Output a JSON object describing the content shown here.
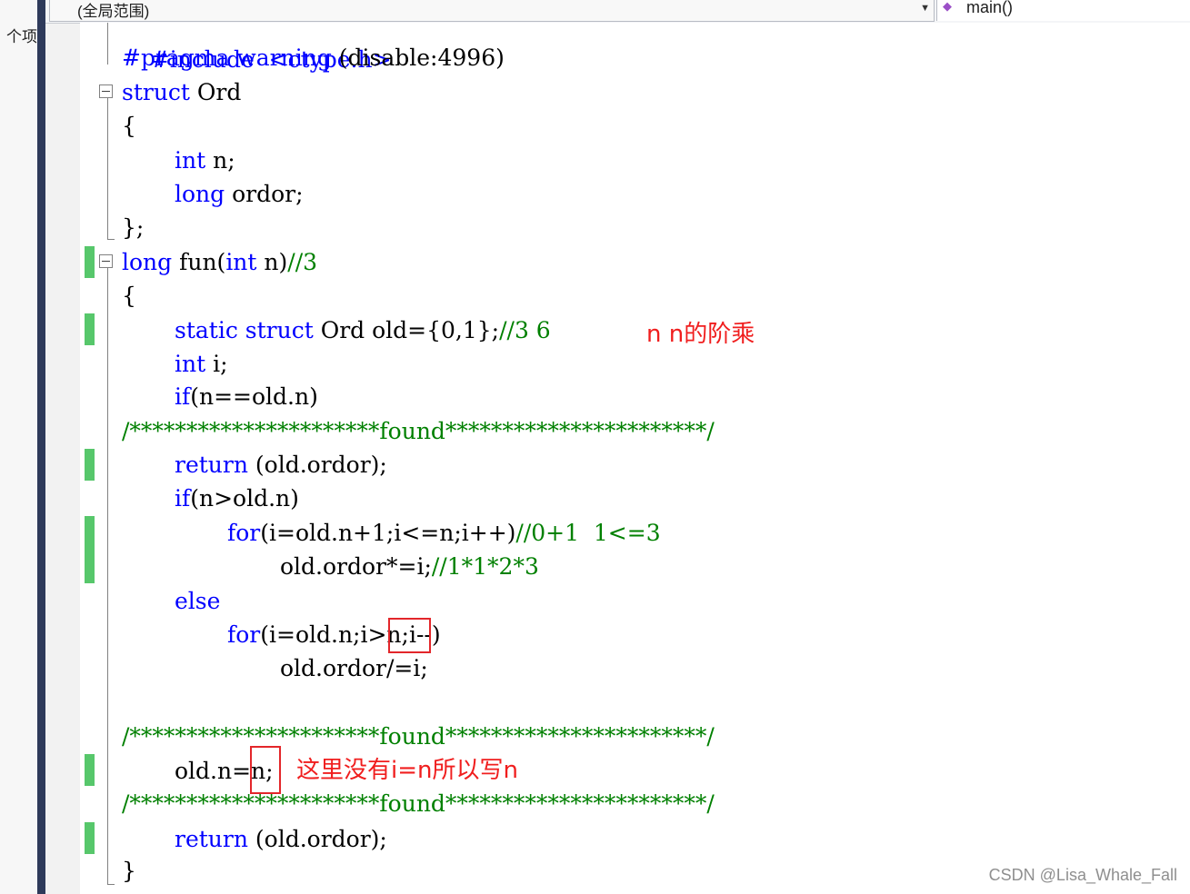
{
  "left_panel": {
    "label": "个项"
  },
  "nav": {
    "scope": "(全局范围)",
    "member": "main()"
  },
  "code": {
    "l0": "#include  <ctype.h>",
    "l1_pp": "#pragma warning",
    "l1_rest": " (disable:4996)",
    "l2_kw": "struct",
    "l2_rest": " Ord",
    "l3": "{",
    "l4_kw": "int",
    "l4_rest": " n;",
    "l5_kw": "long",
    "l5_rest": " ordor;",
    "l6": "};",
    "l7_kw1": "long",
    "l7_mid": " fun(",
    "l7_kw2": "int",
    "l7_rest": " n)",
    "l7_cm": "//3",
    "l8": "{",
    "l9_kw": "static struct",
    "l9_rest": " Ord old={0,1};",
    "l9_cm": "//3 6",
    "l10_kw": "int",
    "l10_rest": " i;",
    "l11_kw": "if",
    "l11_rest": "(n==old.n)",
    "l12_cm": "/**********************found***********************/",
    "l13_kw": "return",
    "l13_rest": " (old.ordor);",
    "l14_kw": "if",
    "l14_rest": "(n>old.n)",
    "l15_kw": "for",
    "l15_rest": "(i=old.n+1;i<=n;i++)",
    "l15_cm": "//0+1  1<=3",
    "l16_rest": "old.ordor*=i;",
    "l16_cm": "//1*1*2*3",
    "l17_kw": "else",
    "l18_kw": "for",
    "l18_a": "(i=old.n;",
    "l18_b": "i>n",
    "l18_c": ";i--)",
    "l19": "old.ordor/=i;",
    "l21_cm": "/**********************found***********************/",
    "l22_a": "old.n=",
    "l22_b": "n;",
    "l23_cm": "/**********************found***********************/",
    "l24_kw": "return",
    "l24_rest": " (old.ordor);",
    "l25": "}"
  },
  "annotations": {
    "factorial_note": "n n的阶乘",
    "assign_note": "这里没有i=n所以写n"
  },
  "watermark": "CSDN @Lisa_Whale_Fall",
  "colors": {
    "keyword": "#0000ff",
    "comment": "#008000",
    "annotation": "#f01e1e",
    "change_bar": "#57c76b"
  }
}
